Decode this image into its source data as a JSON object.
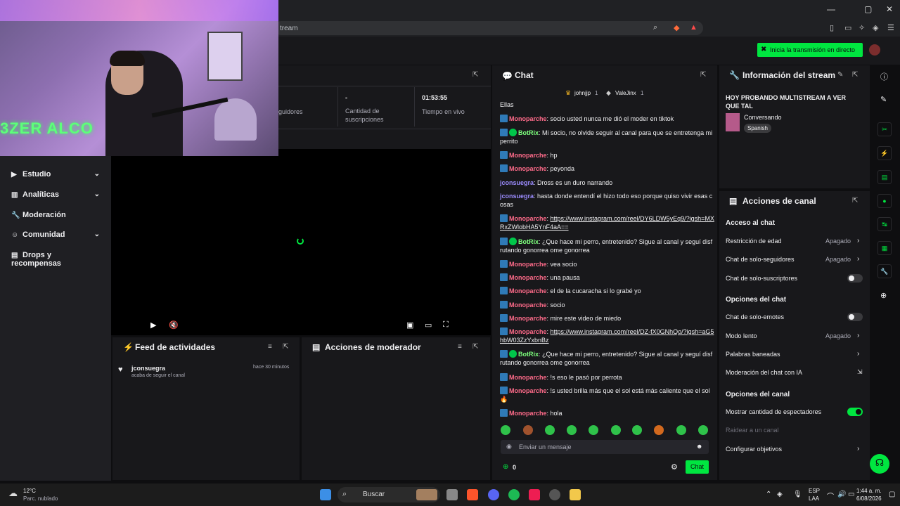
{
  "browser": {
    "url_fragment": "tream",
    "window_controls": [
      "—",
      "▢",
      "✕"
    ]
  },
  "header": {
    "live_button": "Inicia la transmisión en directo"
  },
  "webcam": {
    "neon_text": "3ZER ALCO"
  },
  "nav": {
    "items": [
      {
        "label": "Estudio",
        "icon": "video-camera-icon",
        "expandable": true
      },
      {
        "label": "Analíticas",
        "icon": "chart-icon",
        "expandable": true
      },
      {
        "label": "Moderación",
        "icon": "wrench-icon",
        "expandable": false
      },
      {
        "label": "Comunidad",
        "icon": "people-icon",
        "expandable": true
      },
      {
        "label": "Drops y recompensas",
        "icon": "gift-icon",
        "expandable": false
      }
    ]
  },
  "stats": {
    "followers_label": "guidores",
    "subs_value": "-",
    "subs_label": "Cantidad de suscripciones",
    "live_time_value": "01:53:55",
    "live_time_label": "Tiempo en vivo"
  },
  "feed": {
    "title": "Feed de actividades",
    "items": [
      {
        "user": "jconsuegra",
        "action": "acaba de seguir el canal",
        "time": "hace 30 minutos"
      }
    ]
  },
  "moderator": {
    "title": "Acciones de moderador"
  },
  "chat": {
    "title": "Chat",
    "pinned_users": [
      "johnjjp",
      "ValeJinx"
    ],
    "pinned_counts": [
      "1",
      "1"
    ],
    "top_fragment": "Ellas",
    "messages": [
      {
        "user": "Monoparche",
        "text": "socio usted nunca me dió el moder en tiktok",
        "color": "#ff6b8a",
        "badge": "mod"
      },
      {
        "user": "BotRix",
        "text": "Mi socio, no olvide seguir al canal para que se entretenga mi perrito",
        "color": "#7dff7d",
        "badge": "bot"
      },
      {
        "user": "Monoparche",
        "text": "hp",
        "color": "#ff6b8a",
        "badge": "mod"
      },
      {
        "user": "Monoparche",
        "text": "peyonda",
        "color": "#ff6b8a",
        "badge": "mod"
      },
      {
        "user": "jconsuegra",
        "text": "Dross es un duro narrando",
        "color": "#9c8cff",
        "badge": "none"
      },
      {
        "user": "jconsuegra",
        "text": "hasta donde entendí el hizo todo eso porque quiso vivir esas cosas",
        "color": "#9c8cff",
        "badge": "none"
      },
      {
        "user": "Monoparche",
        "text": "https://www.instagram.com/reel/DY6LDW5yEq9/?igsh=MXRxZWlobHA5YnF4aA==",
        "color": "#ff6b8a",
        "badge": "mod",
        "link": true
      },
      {
        "user": "BotRix",
        "text": "¿Que hace mi perro, entretenido? Sigue al canal y seguí disfrutando gonorrea ome gonorrea",
        "color": "#7dff7d",
        "badge": "bot"
      },
      {
        "user": "Monoparche",
        "text": "vea socio",
        "color": "#ff6b8a",
        "badge": "mod"
      },
      {
        "user": "Monoparche",
        "text": "una pausa",
        "color": "#ff6b8a",
        "badge": "mod"
      },
      {
        "user": "Monoparche",
        "text": "el de la cucaracha si lo grabé yo",
        "color": "#ff6b8a",
        "badge": "mod"
      },
      {
        "user": "Monoparche",
        "text": "socio",
        "color": "#ff6b8a",
        "badge": "mod"
      },
      {
        "user": "Monoparche",
        "text": "mire este video de miedo",
        "color": "#ff6b8a",
        "badge": "mod"
      },
      {
        "user": "Monoparche",
        "text": "https://www.instagram.com/reel/DZ-fX0GNhQo/?igsh=aG5hbW03ZzYxbnBz",
        "color": "#ff6b8a",
        "badge": "mod",
        "link": true
      },
      {
        "user": "BotRix",
        "text": "¿Que hace mi perro, entretenido? Sigue al canal y seguí disfrutando gonorrea ome gonorrea",
        "color": "#7dff7d",
        "badge": "bot"
      },
      {
        "user": "Monoparche",
        "text": "!s eso le pasó por perrota",
        "color": "#ff6b8a",
        "badge": "mod"
      },
      {
        "user": "Monoparche",
        "text": "!s usted brilla más que el sol está más caliente que el sol 🔥",
        "color": "#ff6b8a",
        "badge": "mod"
      },
      {
        "user": "Monoparche",
        "text": "hola",
        "color": "#ff6b8a",
        "badge": "mod"
      }
    ],
    "input_placeholder": "Enviar un mensaje",
    "points": "0",
    "send_label": "Chat"
  },
  "stream_info": {
    "title": "Información del stream",
    "stream_title": "HOY PROBANDO MULTISTREAM A VER QUE TAL",
    "category": "Conversando",
    "language": "Spanish"
  },
  "channel_actions": {
    "title": "Acciones de canal",
    "chat_access": "Acceso al chat",
    "age_restriction": "Restricción de edad",
    "age_restriction_val": "Apagado",
    "followers_only": "Chat de solo-seguidores",
    "followers_only_val": "Apagado",
    "subs_only": "Chat de solo-suscriptores",
    "chat_options": "Opciones del chat",
    "emotes_only": "Chat de solo-emotes",
    "slow_mode": "Modo lento",
    "slow_mode_val": "Apagado",
    "banned_words": "Palabras baneadas",
    "ai_moderation": "Moderación del chat con IA",
    "channel_options": "Opciones del canal",
    "show_viewers": "Mostrar cantidad de espectadores",
    "raid": "Raidear a un canal",
    "goals": "Configurar objetivos"
  },
  "taskbar": {
    "temp": "12°C",
    "weather": "Parc. nublado",
    "search": "Buscar",
    "lang": "ESP",
    "region": "LAA",
    "time": "1:44 a. m.",
    "date": "6/08/2026"
  }
}
